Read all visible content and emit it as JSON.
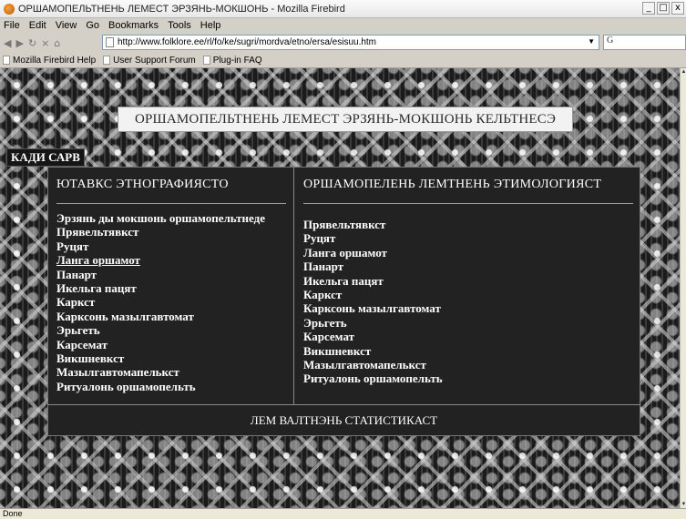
{
  "window": {
    "title": "ОРШАМОПЕЛЬТНЕНЬ ЛЕМЕСТ ЭРЗЯНЬ-МОКШОНЬ - Mozilla Firebird",
    "minimize": "_",
    "maximize": "□",
    "close": "x"
  },
  "menu": {
    "file": "File",
    "edit": "Edit",
    "view": "View",
    "go": "Go",
    "bookmarks": "Bookmarks",
    "tools": "Tools",
    "help": "Help"
  },
  "nav": {
    "back": "◀",
    "forward": "▶",
    "reload": "↻",
    "stop": "×",
    "home": "⌂",
    "url": "http://www.folklore.ee/rl/fo/ke/sugri/mordva/etno/ersa/esisuu.htm",
    "url_dropdown": "▼",
    "search_text": "G"
  },
  "bookmarks_bar": [
    "Mozilla Firebird Help",
    "User Support Forum",
    "Plug-in FAQ"
  ],
  "page": {
    "site_title": "ОРШАМОПЕЛЬТНЕНЬ ЛЕМЕСТ ЭРЗЯНЬ-МОКШОНЬ КЕЛЬТНЕСЭ",
    "home_link": "КАДИ САРВ",
    "left_column": {
      "heading": "ЮТАВКС ЭТНОГРАФИЯСТО",
      "items": [
        "Эрзянь ды мокшонь оршамопельтнеде",
        "Прявельтявкст",
        "Руцят",
        "Ланга оршамот",
        "Панарт",
        "Икельга пацят",
        "Каркст",
        "Карксонь мазылгавтомат",
        "Эрьгеть",
        "Карсемат",
        "Викшневкст",
        "Мазылгавтомапелькст",
        "Ритуалонь оршамопельть"
      ]
    },
    "right_column": {
      "heading": "ОРШАМОПЕЛЕНЬ ЛЕМТНЕНЬ ЭТИМОЛОГИЯСТ",
      "items": [
        "Прявельтявкст",
        "Руцят",
        "Ланга оршамот",
        "Панарт",
        "Икельга пацят",
        "Каркст",
        "Карксонь мазылгавтомат",
        "Эрьгеть",
        "Карсемат",
        "Викшневкст",
        "Мазылгавтомапелькст",
        "Ритуалонь оршамопельть"
      ]
    },
    "footer_link": "ЛЕМ ВАЛТНЭНЬ СТАТИСТИКАСТ"
  },
  "status": "Done"
}
